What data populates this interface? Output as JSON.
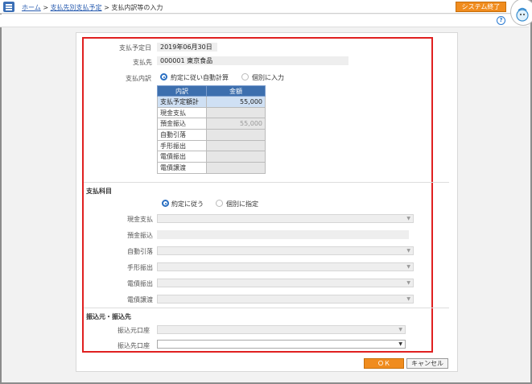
{
  "breadcrumb": {
    "home": "ホーム",
    "sep1": ">",
    "payee": "支払先別支払予定",
    "sep2": ">",
    "current": "支払内訳等の入力"
  },
  "header": {
    "system_exit": "システム終了",
    "help_icon": "?"
  },
  "form": {
    "due_date_label": "支払予定日",
    "due_date": "2019年06月30日",
    "payee_label": "支払先",
    "payee": "000001 東京食品",
    "breakdown_label": "支払内訳",
    "breakdown_opt_auto": "約定に従い自動計算",
    "breakdown_opt_manual": "個別に入力"
  },
  "breakdown_table": {
    "headers": [
      "内訳",
      "金額"
    ],
    "rows": [
      {
        "label": "支払予定額計",
        "amount": "55,000"
      },
      {
        "label": "現金支払",
        "amount": ""
      },
      {
        "label": "預金振込",
        "amount": "55,000"
      },
      {
        "label": "自動引落",
        "amount": ""
      },
      {
        "label": "手形振出",
        "amount": ""
      },
      {
        "label": "電債振出",
        "amount": ""
      },
      {
        "label": "電債譲渡",
        "amount": ""
      }
    ]
  },
  "subjects": {
    "title": "支払科目",
    "opt_contract": "約定に従う",
    "opt_individual": "個別に指定",
    "rows": [
      "現金支払",
      "預金振込",
      "自動引落",
      "手形振出",
      "電債振出",
      "電債譲渡"
    ]
  },
  "accounts": {
    "title": "振込元・振込先",
    "from_label": "振込元口座",
    "to_label": "振込先口座"
  },
  "buttons": {
    "ok": "ＯＫ",
    "cancel": "キャンセル"
  }
}
